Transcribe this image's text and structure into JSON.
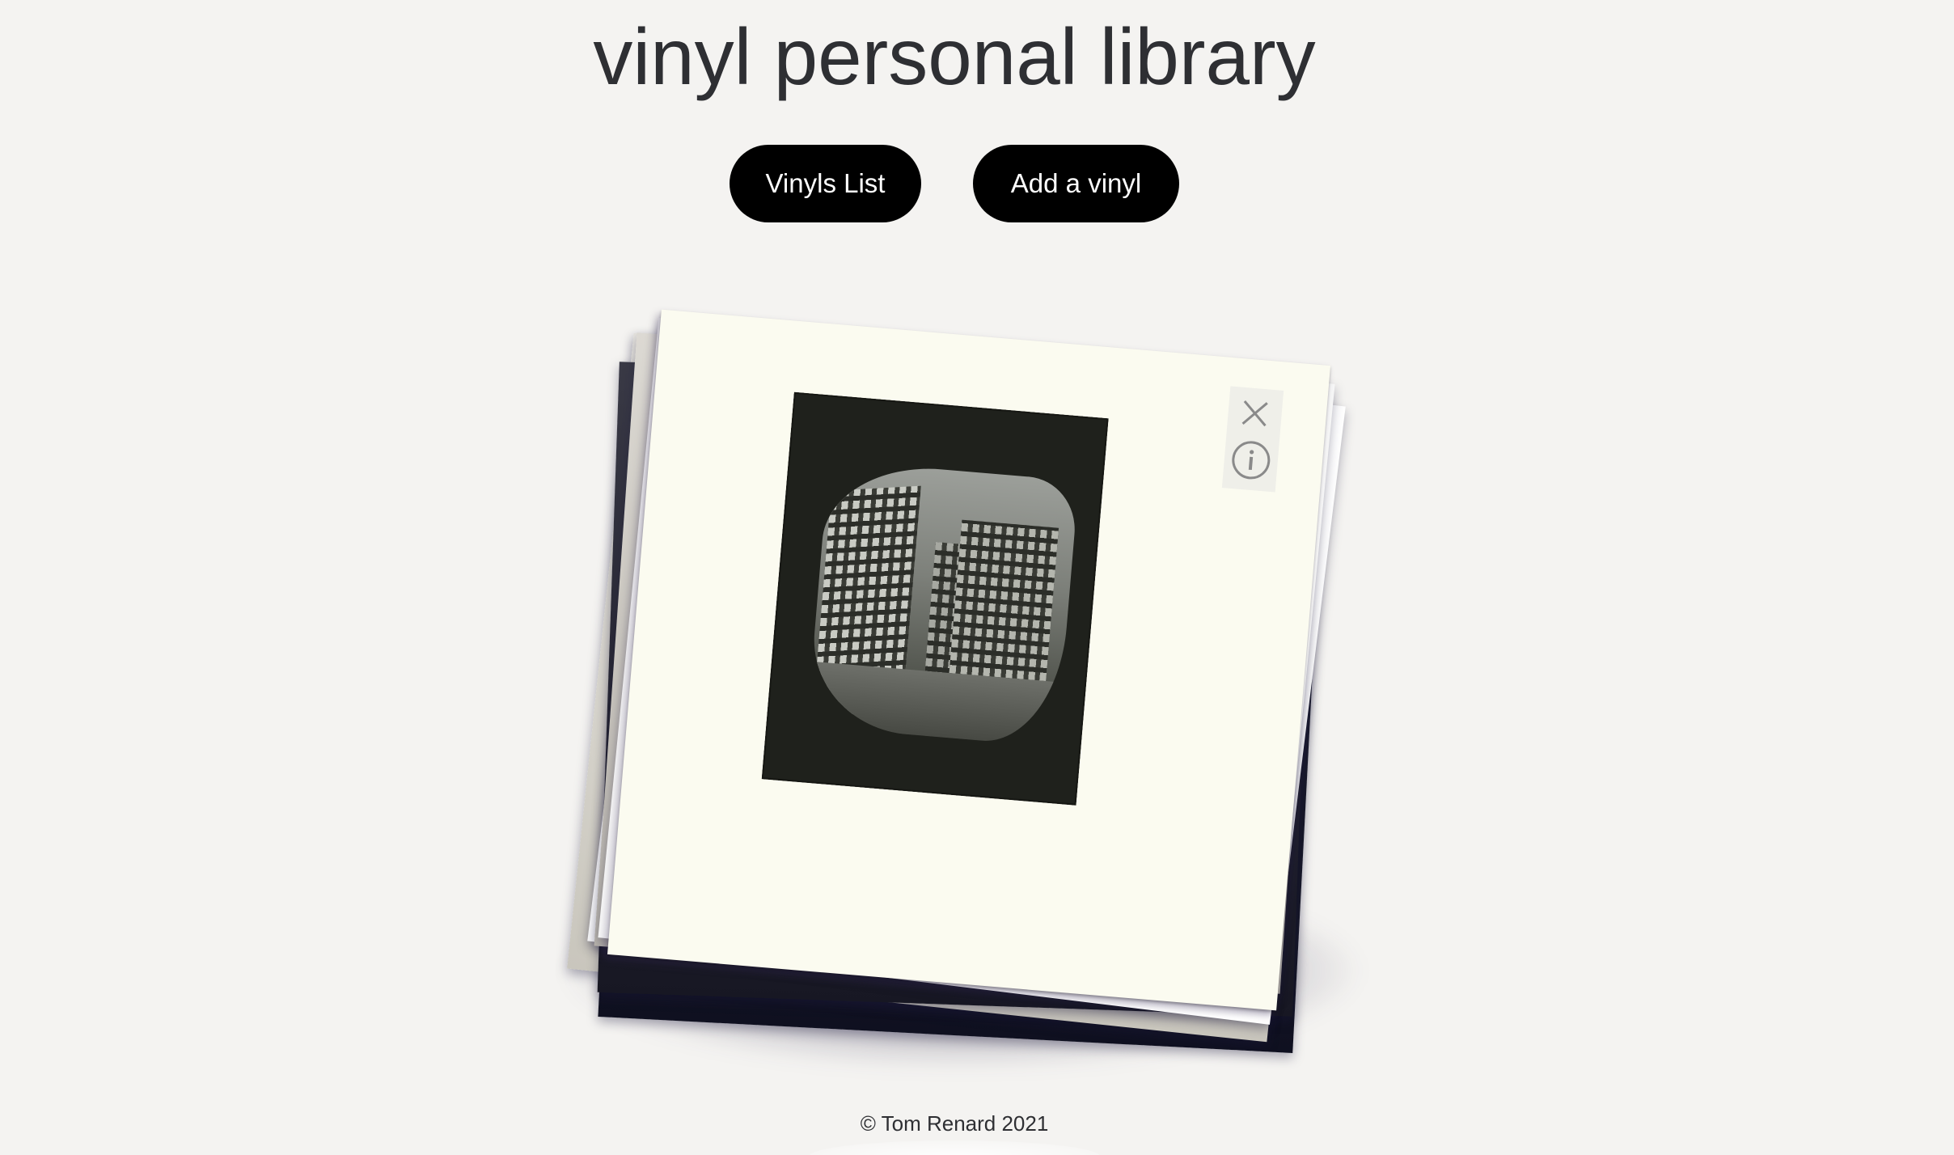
{
  "header": {
    "title": "vinyl personal library"
  },
  "nav": {
    "vinyls_list_label": "Vinyls List",
    "add_vinyl_label": "Add a vinyl"
  },
  "card_controls": {
    "close_icon": "close-icon",
    "info_icon": "info-icon"
  },
  "colors": {
    "background": "#f4f3f1",
    "button_bg": "#000000",
    "button_text": "#ffffff",
    "title_text": "#2e2f33",
    "cover_bg": "#fbfbf0"
  },
  "footer": {
    "copyright": "© Tom Renard 2021"
  }
}
